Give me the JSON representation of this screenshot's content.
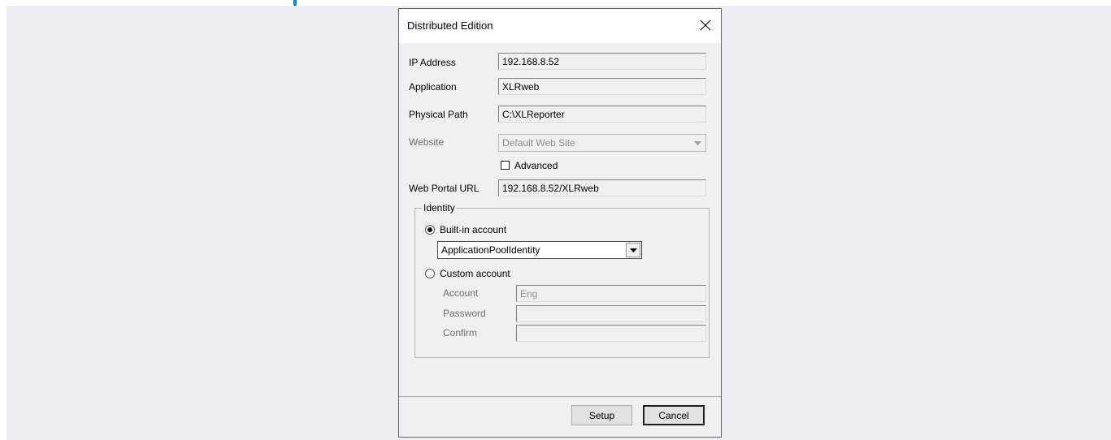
{
  "dialog": {
    "title": "Distributed Edition",
    "fields": {
      "ip_address": {
        "label": "IP Address",
        "value": "192.168.8.52"
      },
      "application": {
        "label": "Application",
        "value": "XLRweb"
      },
      "physical_path": {
        "label": "Physical Path",
        "value": "C:\\XLReporter"
      },
      "website": {
        "label": "Website",
        "value": "Default Web Site"
      },
      "advanced": {
        "label": "Advanced",
        "checked": false
      },
      "web_portal_url": {
        "label": "Web Portal URL",
        "value": "192.168.8.52/XLRweb"
      }
    },
    "identity": {
      "legend": "Identity",
      "builtin": {
        "label": "Built-in account",
        "selected": true,
        "value": "ApplicationPoolIdentity"
      },
      "custom": {
        "label": "Custom account",
        "selected": false,
        "account": {
          "label": "Account",
          "value": "Eng"
        },
        "password": {
          "label": "Password",
          "value": ""
        },
        "confirm": {
          "label": "Confirm",
          "value": ""
        }
      }
    },
    "buttons": {
      "setup": "Setup",
      "cancel": "Cancel"
    }
  },
  "icons": {
    "close": "close-icon",
    "dropdown": "chevron-down-icon",
    "radio_selected": "radio-selected",
    "radio_unselected": "radio-unselected"
  },
  "colors": {
    "accent": "#1a82e2",
    "backdrop": "#ebeef2",
    "dialog_bg": "#f0f0f0"
  }
}
